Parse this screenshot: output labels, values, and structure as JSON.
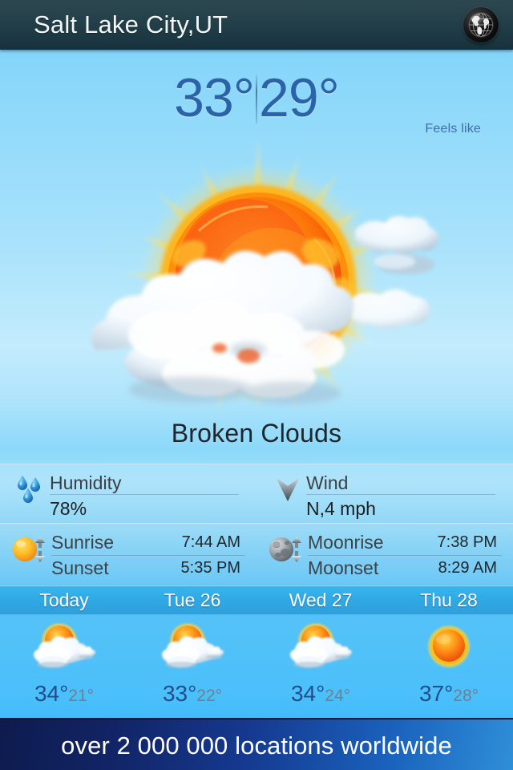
{
  "header": {
    "title": "Salt Lake City,UT",
    "globe_icon": "globe-icon"
  },
  "current": {
    "temperature": "33°",
    "feels_like_temperature": "29°",
    "feels_like_label": "Feels like",
    "condition": "Broken Clouds",
    "condition_icon": "sun-behind-broken-clouds-icon"
  },
  "details": {
    "humidity": {
      "icon": "water-drops-icon",
      "label": "Humidity",
      "value": "78%"
    },
    "wind": {
      "icon": "wind-direction-arrow-icon",
      "label": "Wind",
      "value": "N,4 mph"
    },
    "sun": {
      "icon": "sun-icon",
      "rise_label": "Sunrise",
      "rise_time": "7:44 AM",
      "set_label": "Sunset",
      "set_time": "5:35 PM"
    },
    "moon": {
      "icon": "moon-icon",
      "rise_label": "Moonrise",
      "rise_time": "7:38 PM",
      "set_label": "Moonset",
      "set_time": "8:29 AM"
    }
  },
  "forecast": [
    {
      "day": "Today",
      "icon": "sun-behind-cloud-icon",
      "high": "34°",
      "low": "21°"
    },
    {
      "day": "Tue 26",
      "icon": "sun-behind-cloud-icon",
      "high": "33°",
      "low": "22°"
    },
    {
      "day": "Wed 27",
      "icon": "sun-behind-cloud-icon",
      "high": "34°",
      "low": "24°"
    },
    {
      "day": "Thu 28",
      "icon": "sun-icon",
      "high": "37°",
      "low": "28°"
    }
  ],
  "banner": {
    "text": "over 2 000 000 locations worldwide"
  },
  "colors": {
    "header_bg": "#23404a",
    "temp_text": "#2a63a8",
    "forecast_header_bg": "#30a8e4",
    "banner_gradient_start": "#0d1b4e",
    "banner_gradient_end": "#2f8fd8",
    "sky_top": "#74cdf8",
    "sky_bottom": "#43bcfb"
  }
}
